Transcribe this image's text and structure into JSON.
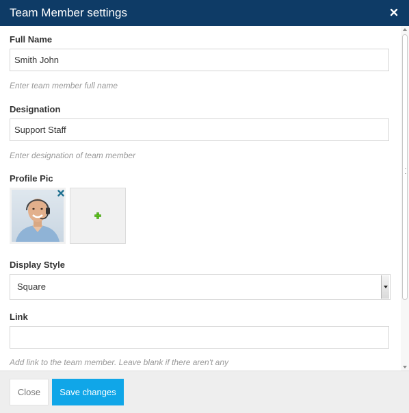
{
  "dialog": {
    "title": "Team Member settings",
    "close_icon": "close-icon"
  },
  "fields": {
    "full_name": {
      "label": "Full Name",
      "value": "Smith John",
      "help": "Enter team member full name"
    },
    "designation": {
      "label": "Designation",
      "value": "Support Staff",
      "help": "Enter designation of team member"
    },
    "profile_pic": {
      "label": "Profile Pic",
      "image": "avatar-photo",
      "remove_icon": "remove-icon",
      "add_icon": "plus-icon"
    },
    "display_style": {
      "label": "Display Style",
      "selected": "Square",
      "arrow_icon": "chevron-down-icon"
    },
    "link": {
      "label": "Link",
      "value": "",
      "help": "Add link to the team member. Leave blank if there aren't any"
    }
  },
  "footer": {
    "close_label": "Close",
    "save_label": "Save changes"
  },
  "colors": {
    "header_bg": "#0e3b66",
    "primary_button": "#10a6e8",
    "footer_bg": "#eeeeee",
    "add_icon": "#5cc21e"
  }
}
